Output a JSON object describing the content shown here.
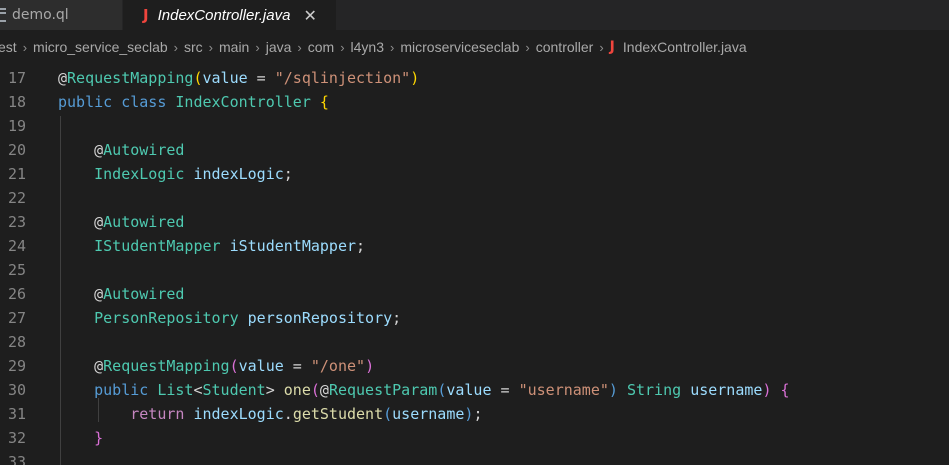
{
  "tabs": [
    {
      "label": "demo.ql",
      "active": false
    },
    {
      "label": "IndexController.java",
      "active": true
    }
  ],
  "tab_icons": {
    "java": "J",
    "close": "✕"
  },
  "breadcrumb": {
    "items": [
      "est",
      "micro_service_seclab",
      "src",
      "main",
      "java",
      "com",
      "l4yn3",
      "microserviceseclab",
      "controller",
      "IndexController.java"
    ],
    "separator": "›"
  },
  "colors": {
    "background": "#1e1e1e",
    "tab_bar": "#252526",
    "java_icon": "#f0453d",
    "keyword": "#569cd6",
    "type": "#4ec9b0",
    "variable": "#9cdcfe",
    "string": "#ce9178",
    "function": "#dcdcaa"
  },
  "code": {
    "lines": [
      {
        "n": "17",
        "tokens": [
          [
            "@",
            "tk-plain"
          ],
          [
            "RequestMapping",
            "tk-type"
          ],
          [
            "(",
            "tk-brace"
          ],
          [
            "value",
            "tk-var"
          ],
          [
            " = ",
            "tk-plain"
          ],
          [
            "\"/sqlinjection\"",
            "tk-str"
          ],
          [
            ")",
            "tk-brace"
          ]
        ]
      },
      {
        "n": "18",
        "tokens": [
          [
            "public",
            "tk-kw"
          ],
          [
            " ",
            "tk-plain"
          ],
          [
            "class",
            "tk-kw"
          ],
          [
            " ",
            "tk-plain"
          ],
          [
            "IndexController",
            "tk-type"
          ],
          [
            " ",
            "tk-plain"
          ],
          [
            "{",
            "tk-brace"
          ]
        ]
      },
      {
        "n": "19",
        "tokens": []
      },
      {
        "n": "20",
        "tokens": [
          [
            "    ",
            "tk-plain"
          ],
          [
            "@",
            "tk-plain"
          ],
          [
            "Autowired",
            "tk-type"
          ]
        ]
      },
      {
        "n": "21",
        "tokens": [
          [
            "    ",
            "tk-plain"
          ],
          [
            "IndexLogic",
            "tk-type"
          ],
          [
            " ",
            "tk-plain"
          ],
          [
            "indexLogic",
            "tk-var"
          ],
          [
            ";",
            "tk-plain"
          ]
        ]
      },
      {
        "n": "22",
        "tokens": []
      },
      {
        "n": "23",
        "tokens": [
          [
            "    ",
            "tk-plain"
          ],
          [
            "@",
            "tk-plain"
          ],
          [
            "Autowired",
            "tk-type"
          ]
        ]
      },
      {
        "n": "24",
        "tokens": [
          [
            "    ",
            "tk-plain"
          ],
          [
            "IStudentMapper",
            "tk-type"
          ],
          [
            " ",
            "tk-plain"
          ],
          [
            "iStudentMapper",
            "tk-var"
          ],
          [
            ";",
            "tk-plain"
          ]
        ]
      },
      {
        "n": "25",
        "tokens": []
      },
      {
        "n": "26",
        "tokens": [
          [
            "    ",
            "tk-plain"
          ],
          [
            "@",
            "tk-plain"
          ],
          [
            "Autowired",
            "tk-type"
          ]
        ]
      },
      {
        "n": "27",
        "tokens": [
          [
            "    ",
            "tk-plain"
          ],
          [
            "PersonRepository",
            "tk-type"
          ],
          [
            " ",
            "tk-plain"
          ],
          [
            "personRepository",
            "tk-var"
          ],
          [
            ";",
            "tk-plain"
          ]
        ]
      },
      {
        "n": "28",
        "tokens": []
      },
      {
        "n": "29",
        "tokens": [
          [
            "    ",
            "tk-plain"
          ],
          [
            "@",
            "tk-plain"
          ],
          [
            "RequestMapping",
            "tk-type"
          ],
          [
            "(",
            "tk-paren"
          ],
          [
            "value",
            "tk-var"
          ],
          [
            " = ",
            "tk-plain"
          ],
          [
            "\"/one\"",
            "tk-str"
          ],
          [
            ")",
            "tk-paren"
          ]
        ]
      },
      {
        "n": "30",
        "tokens": [
          [
            "    ",
            "tk-plain"
          ],
          [
            "public",
            "tk-kw"
          ],
          [
            " ",
            "tk-plain"
          ],
          [
            "List",
            "tk-type"
          ],
          [
            "<",
            "tk-plain"
          ],
          [
            "Student",
            "tk-type"
          ],
          [
            "> ",
            "tk-plain"
          ],
          [
            "one",
            "tk-fn"
          ],
          [
            "(",
            "tk-paren"
          ],
          [
            "@",
            "tk-plain"
          ],
          [
            "RequestParam",
            "tk-type"
          ],
          [
            "(",
            "tk-kw"
          ],
          [
            "value",
            "tk-var"
          ],
          [
            " = ",
            "tk-plain"
          ],
          [
            "\"username\"",
            "tk-str"
          ],
          [
            ")",
            "tk-kw"
          ],
          [
            " ",
            "tk-plain"
          ],
          [
            "String",
            "tk-type"
          ],
          [
            " ",
            "tk-plain"
          ],
          [
            "username",
            "tk-var"
          ],
          [
            ")",
            "tk-paren"
          ],
          [
            " ",
            "tk-plain"
          ],
          [
            "{",
            "tk-paren"
          ]
        ]
      },
      {
        "n": "31",
        "tokens": [
          [
            "        ",
            "tk-plain"
          ],
          [
            "return",
            "tk-kw2"
          ],
          [
            " ",
            "tk-plain"
          ],
          [
            "indexLogic",
            "tk-var"
          ],
          [
            ".",
            "tk-plain"
          ],
          [
            "getStudent",
            "tk-fn"
          ],
          [
            "(",
            "tk-kw"
          ],
          [
            "username",
            "tk-var"
          ],
          [
            ")",
            "tk-kw"
          ],
          [
            ";",
            "tk-plain"
          ]
        ]
      },
      {
        "n": "32",
        "tokens": [
          [
            "    ",
            "tk-plain"
          ],
          [
            "}",
            "tk-paren"
          ]
        ]
      },
      {
        "n": "33",
        "tokens": []
      }
    ]
  }
}
